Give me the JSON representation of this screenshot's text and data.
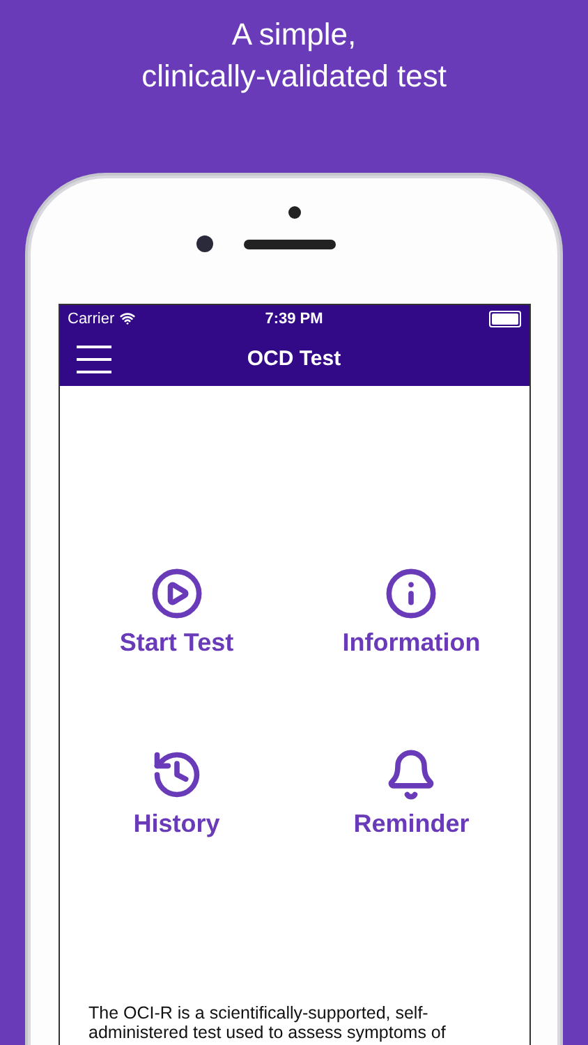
{
  "headline": [
    "A simple,",
    "clinically-validated test"
  ],
  "status_bar": {
    "carrier": "Carrier",
    "time": "7:39 PM"
  },
  "nav_bar": {
    "title": "OCD Test"
  },
  "menu_items": [
    {
      "label": "Start Test",
      "kind": "play"
    },
    {
      "label": "Information",
      "kind": "info"
    },
    {
      "label": "History",
      "kind": "history"
    },
    {
      "label": "Reminder",
      "kind": "bell"
    }
  ],
  "description": "The OCI-R is a scientifically-supported, self-administered test used to assess symptoms of"
}
